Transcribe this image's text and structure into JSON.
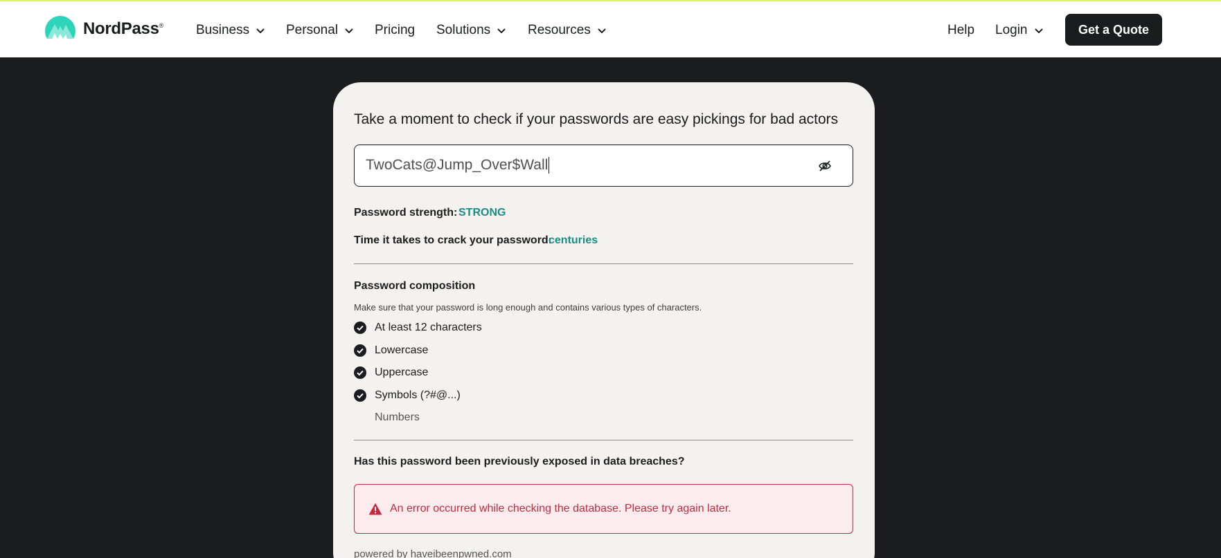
{
  "brand": {
    "name": "NordPass",
    "reg_mark": "®",
    "logo_color": "#2cd4b9",
    "accent_line_color": "#d7f36b"
  },
  "nav": {
    "business": "Business",
    "personal": "Personal",
    "pricing": "Pricing",
    "solutions": "Solutions",
    "resources": "Resources",
    "help": "Help",
    "login": "Login",
    "cta": "Get a Quote"
  },
  "checker": {
    "heading": "Take a moment to check if your passwords are easy pickings for bad actors",
    "password_value": "TwoCats@Jump_Over$Wall",
    "strength_label": "Password strength:",
    "strength_value": "STRONG",
    "crack_label": "Time it takes to crack your password:",
    "crack_value": "centuries",
    "status_color": "#1a8d84"
  },
  "composition": {
    "title": "Password composition",
    "description": "Make sure that your password is long enough and contains various types of characters.",
    "items": [
      {
        "label": "At least 12 characters",
        "met": true
      },
      {
        "label": "Lowercase",
        "met": true
      },
      {
        "label": "Uppercase",
        "met": true
      },
      {
        "label": "Symbols (?#@...)",
        "met": true
      },
      {
        "label": "Numbers",
        "met": false
      }
    ]
  },
  "breach": {
    "title": "Has this password been previously exposed in data breaches?",
    "error": "An error occurred while checking the database. Please try again later.",
    "error_color": "#c8283e",
    "powered_by": "powered by haveibeenpwned.com"
  }
}
